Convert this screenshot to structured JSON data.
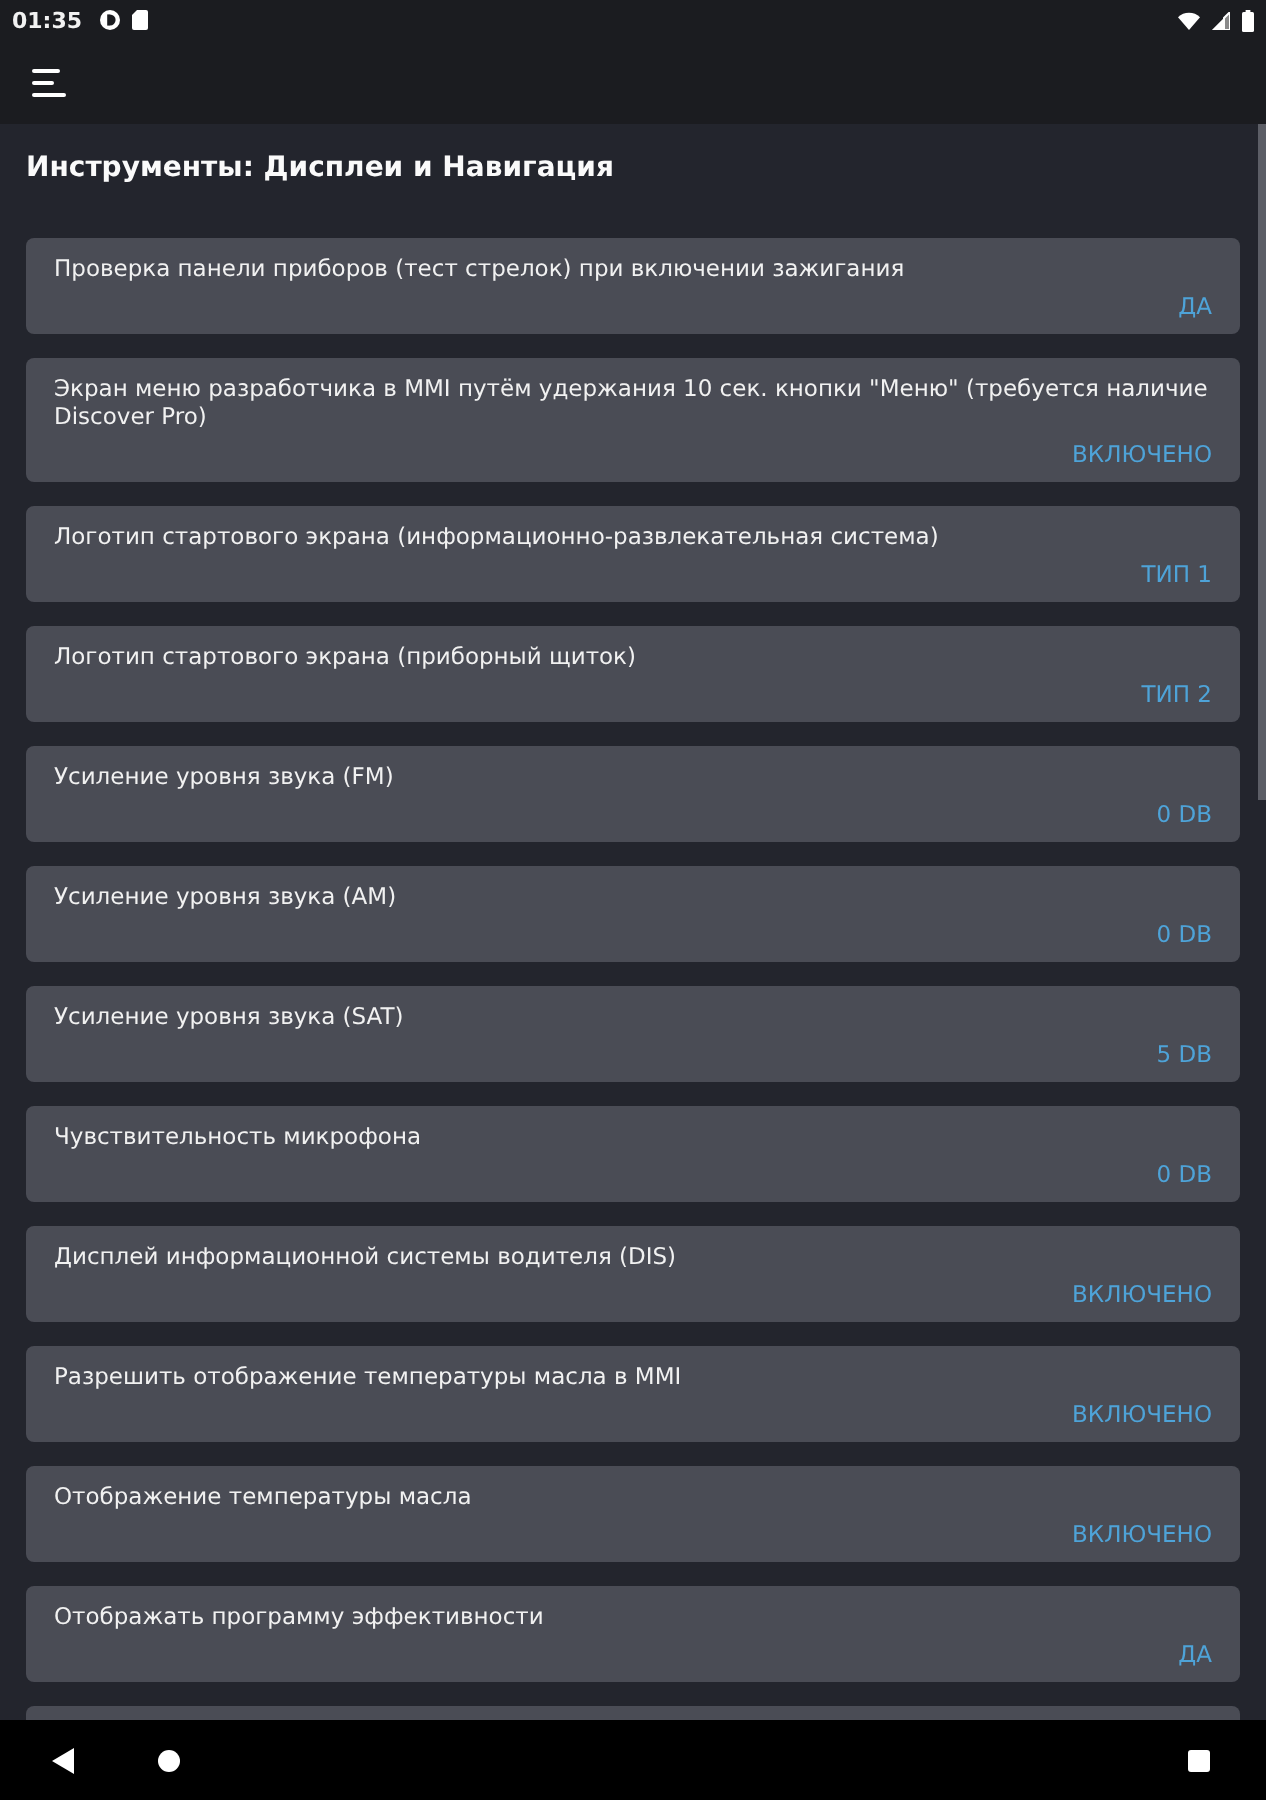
{
  "status_bar": {
    "time": "01:35"
  },
  "page": {
    "title": "Инструменты: Дисплеи и Навигация"
  },
  "settings": [
    {
      "label": "Проверка панели приборов (тест стрелок) при включении зажигания",
      "value": "ДА"
    },
    {
      "label": "Экран меню разработчика в MMI путём удержания 10 сек. кнопки \"Меню\" (требуется наличие Discover Pro)",
      "value": "ВКЛЮЧЕНО"
    },
    {
      "label": "Логотип стартового экрана (информационно-развлекательная система)",
      "value": "ТИП 1"
    },
    {
      "label": "Логотип стартового экрана (приборный щиток)",
      "value": "ТИП 2"
    },
    {
      "label": "Усиление уровня звука (FM)",
      "value": "0 DB"
    },
    {
      "label": "Усиление уровня звука (AM)",
      "value": "0 DB"
    },
    {
      "label": "Усиление уровня звука (SAT)",
      "value": "5 DB"
    },
    {
      "label": "Чувствительность микрофона",
      "value": "0 DB"
    },
    {
      "label": "Дисплей информационной системы водителя (DIS)",
      "value": "ВКЛЮЧЕНО"
    },
    {
      "label": "Разрешить отображение температуры масла в MMI",
      "value": "ВКЛЮЧЕНО"
    },
    {
      "label": "Отображение температуры масла",
      "value": "ВКЛЮЧЕНО"
    },
    {
      "label": "Отображать программу эффективности",
      "value": "ДА"
    }
  ]
}
